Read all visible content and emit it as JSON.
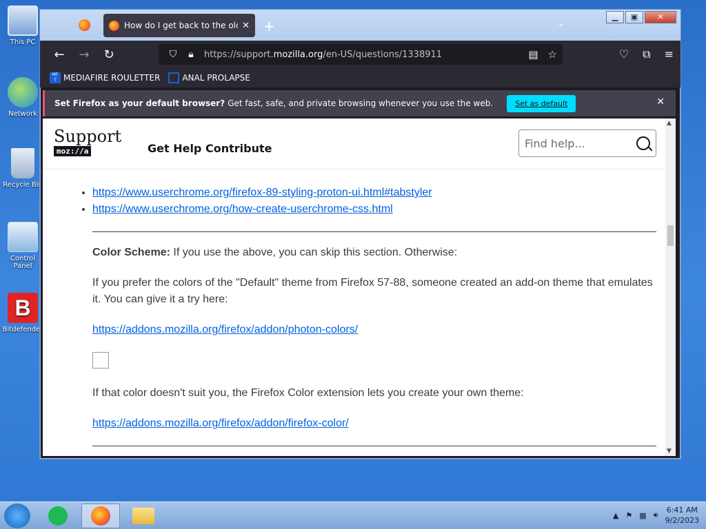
{
  "desktop": {
    "icons": [
      {
        "label": "This PC"
      },
      {
        "label": "Network"
      },
      {
        "label": "Recycle Bin"
      },
      {
        "label": "Control Panel"
      },
      {
        "label": "Bitdefender"
      }
    ]
  },
  "browser": {
    "tab_title": "How do I get back to the old lo",
    "url_prefix": "https://support.",
    "url_domain": "mozilla.org",
    "url_path": "/en-US/questions/1338911",
    "bookmarks": [
      {
        "label": "MEDIAFIRE ROULETTER"
      },
      {
        "label": "ANAL PROLAPSE"
      }
    ],
    "notification": {
      "bold": "Set Firefox as your default browser?",
      "text": "Get fast, safe, and private browsing whenever you use the web.",
      "button": "Set as default"
    }
  },
  "site": {
    "logo_top": "Support",
    "logo_bottom": "moz://a",
    "nav": [
      "Get Help",
      "Contribute"
    ],
    "search_placeholder": "Find help..."
  },
  "article": {
    "links_top": [
      "https://www.userchrome.org/firefox-89-styling-proton-ui.html#tabstyler",
      "https://www.userchrome.org/how-create-userchrome-css.html"
    ],
    "color_scheme_label": "Color Scheme:",
    "color_scheme_text": " If you use the above, you can skip this section. Otherwise:",
    "para_default": "If you prefer the colors of the \"Default\" theme from Firefox 57-88, someone created an add-on theme that emulates it. You can give it a try here:",
    "link_photon": "https://addons.mozilla.org/firefox/addon/photon-colors/",
    "para_color": "If that color doesn't suit you, the Firefox Color extension lets you create your own theme:",
    "link_color": "https://addons.mozilla.org/firefox/addon/firefox-color/"
  },
  "taskbar": {
    "time": "6:41 AM",
    "date": "9/2/2023"
  }
}
